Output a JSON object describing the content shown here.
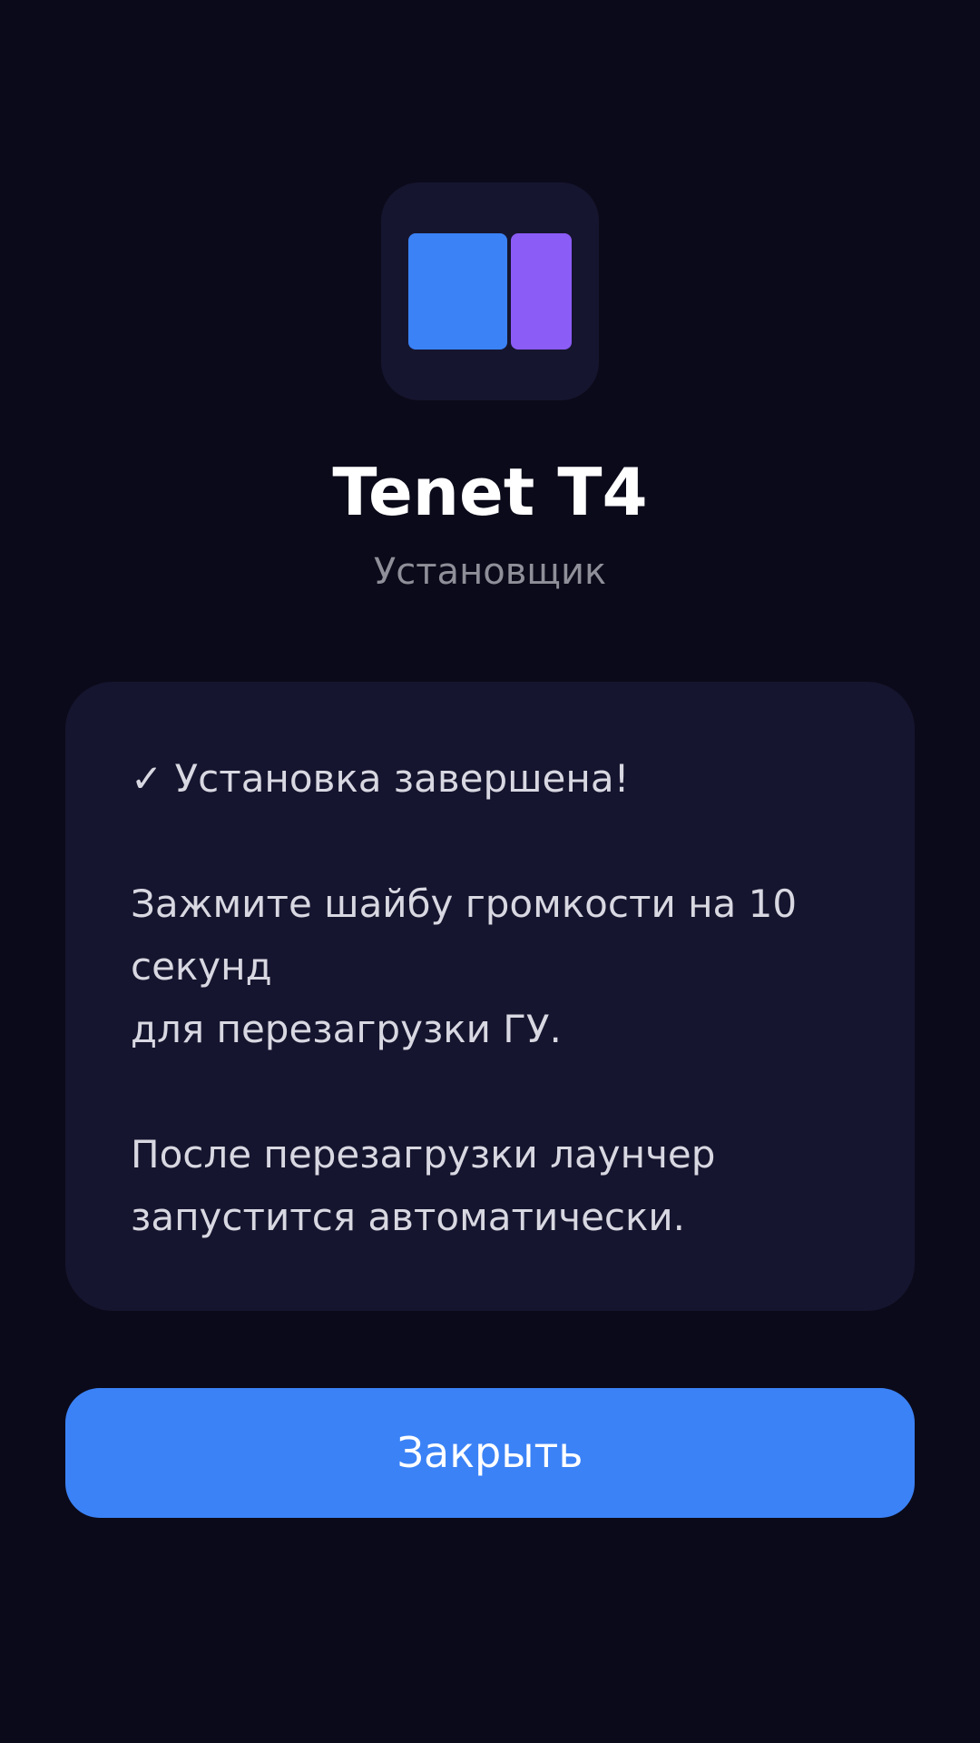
{
  "app": {
    "title": "Tenet T4",
    "subtitle": "Установщик",
    "icon": "app-logo-icon",
    "colors": {
      "background": "#0b0a1a",
      "surface": "#16152f",
      "accent": "#3b82f6",
      "accent_secondary": "#8b5cf6"
    }
  },
  "message": {
    "text": "✓ Установка завершена!\n\nЗажмите шайбу громкости на 10\nсекунд\nдля перезагрузки ГУ.\n\nПосле перезагрузки лаунчер\nзапустится автоматически."
  },
  "actions": {
    "close_label": "Закрыть"
  }
}
